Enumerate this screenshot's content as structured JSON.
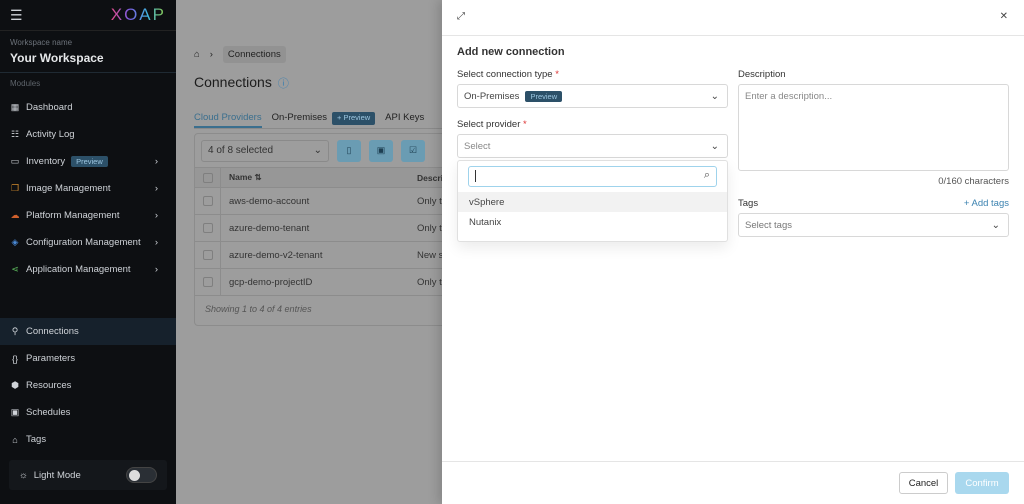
{
  "sidebar": {
    "logo": "XOAP",
    "workspace_label": "Workspace name",
    "workspace_name": "Your Workspace",
    "modules_label": "Modules",
    "items": [
      {
        "label": "Dashboard",
        "icon": "dashboard-icon"
      },
      {
        "label": "Activity Log",
        "icon": "activity-icon"
      },
      {
        "label": "Inventory",
        "badge": "Preview",
        "icon": "inventory-icon"
      },
      {
        "label": "Image Management",
        "icon": "image-icon"
      },
      {
        "label": "Platform Management",
        "icon": "cloud-icon"
      },
      {
        "label": "Configuration Management",
        "icon": "config-icon"
      },
      {
        "label": "Application Management",
        "icon": "share-icon"
      }
    ],
    "items2": [
      {
        "label": "Connections"
      },
      {
        "label": "Parameters"
      },
      {
        "label": "Resources"
      },
      {
        "label": "Schedules"
      },
      {
        "label": "Tags"
      }
    ],
    "mode_label": "Light Mode"
  },
  "main": {
    "breadcrumb": "Connections",
    "title": "Connections",
    "tabs": [
      "Cloud Providers",
      "On-Premises",
      "API Keys"
    ],
    "tab_badge": "+ Preview",
    "selected": "4 of 8 selected",
    "col_name": "Name ⇅",
    "col_desc": "Descri",
    "rows": [
      {
        "name": "aws-demo-account",
        "desc": "Only t"
      },
      {
        "name": "azure-demo-tenant",
        "desc": "Only t"
      },
      {
        "name": "azure-demo-v2-tenant",
        "desc": "New s"
      },
      {
        "name": "gcp-demo-projectID",
        "desc": "Only t"
      }
    ],
    "footer": "Showing 1 to 4 of 4 entries"
  },
  "panel": {
    "title": "Add new connection",
    "type_label": "Select connection type",
    "type_value": "On-Premises",
    "type_badge": "Preview",
    "provider_label": "Select provider",
    "provider_placeholder": "Select",
    "options": [
      "vSphere",
      "Nutanix"
    ],
    "desc_label": "Description",
    "desc_placeholder": "Enter a description...",
    "char_count": "0/160 characters",
    "tags_label": "Tags",
    "add_tags": "+ Add tags",
    "tags_placeholder": "Select tags",
    "cancel": "Cancel",
    "confirm": "Confirm",
    "required": "*"
  }
}
